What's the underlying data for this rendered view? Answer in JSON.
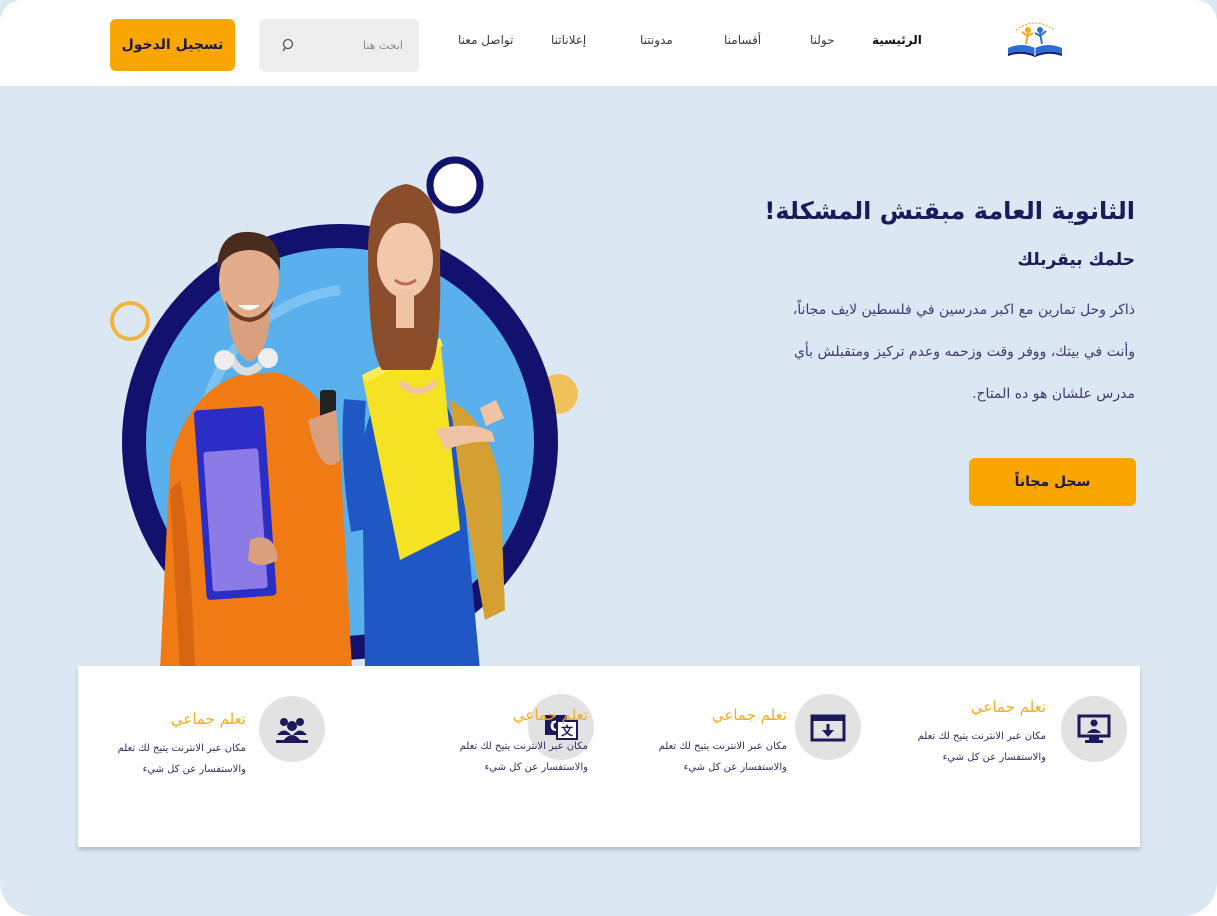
{
  "header": {
    "login_label": "تسجيل الدخول",
    "search_placeholder": "ابحث هنا",
    "nav": {
      "home": "الرئيسية",
      "about": "حولنا",
      "sections": "أقسامنا",
      "blog": "مدونتنا",
      "ads": "إعلاناتنا",
      "contact": "تواصل معنا"
    }
  },
  "hero": {
    "title": "الثانوية العامة مبقتش المشكلة!",
    "subtitle": "حلمك بيقربلك",
    "line1": "ذاكر وحل تمارين مع اكبر مدرسين في فلسطين لايف مجاناً،",
    "line2": "وأنت في بيتك، ووفر وقت وزحمه وعدم تركيز ومتقبلش بأي",
    "line3": "مدرس علشان هو ده المتاح.",
    "cta_label": "سجل مجاناً"
  },
  "features": [
    {
      "title": "تعلم جماعي",
      "line1": "مكان عبر الانترنت يتيح لك تعلم",
      "line2": "والاستفسار عن كل شيء",
      "icon": "monitor-user-icon"
    },
    {
      "title": "تعلم جماعي",
      "line1": "مكان عبر الانترنت يتيح لك تعلم",
      "line2": "والاستفسار عن كل شيء",
      "icon": "download-screen-icon"
    },
    {
      "title": "تعلم جماعي",
      "line1": "مكان عبر الانترنت يتيح لك تعلم",
      "line2": "والاستفسار عن كل شيء",
      "icon": "translate-icon"
    },
    {
      "title": "تعلم جماعي",
      "line1": "مكان عبر الانترنت يتيح لك تعلم",
      "line2": "والاستفسار عن كل شيء",
      "icon": "group-icon"
    }
  ],
  "colors": {
    "accent": "#f9a602",
    "navy": "#1d1a5c",
    "hero_bg": "#dbe8f3",
    "feature_title": "#f2ac1f",
    "circle_blue": "#5ab0ec",
    "ring_navy": "#12126e"
  }
}
